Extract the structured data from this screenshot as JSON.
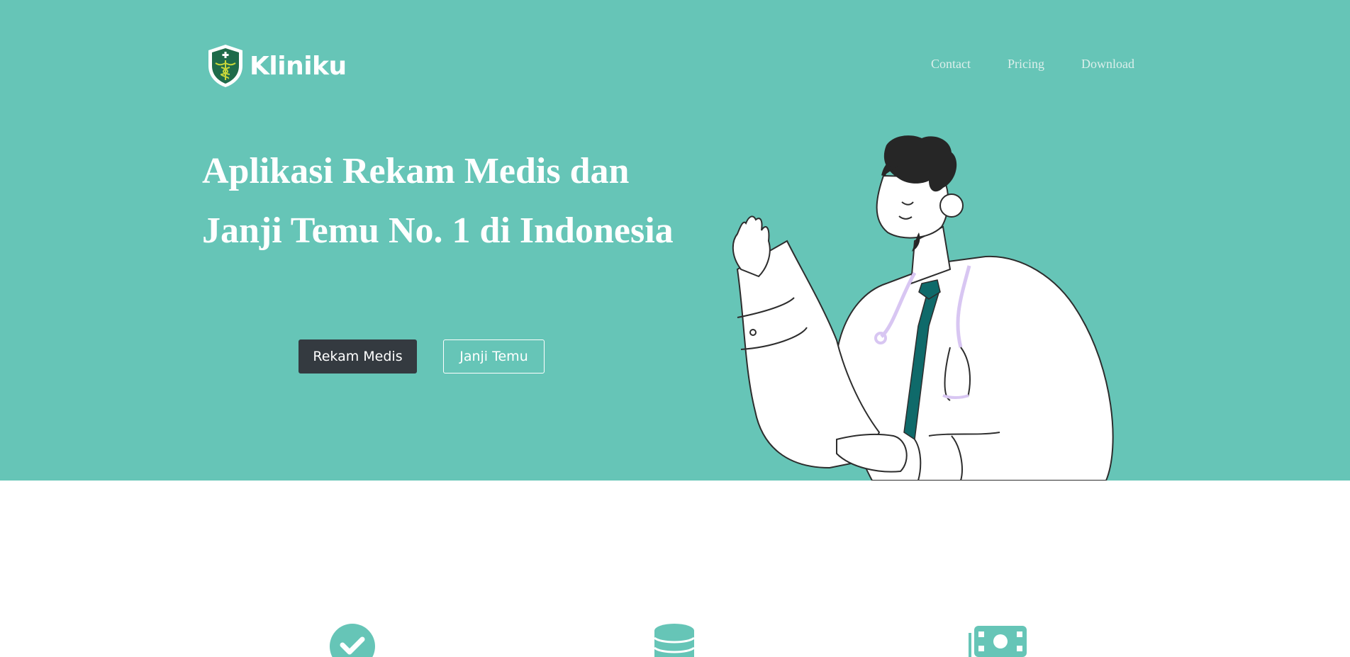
{
  "brand": {
    "name": "Kliniku",
    "logo_icon": "caduceus-shield-icon"
  },
  "nav": {
    "links": [
      "Contact",
      "Pricing",
      "Download"
    ]
  },
  "hero": {
    "title": "Aplikasi Rekam Medis dan Janji Temu No. 1 di Indonesia",
    "primary_button": "Rekam Medis",
    "secondary_button": "Janji Temu",
    "illustration": "doctor-illustration"
  },
  "features": {
    "icons": [
      "check-circle-icon",
      "database-icon",
      "money-bill-icon"
    ]
  },
  "colors": {
    "hero_bg": "#66c5b7",
    "button_dark": "#343a40",
    "white": "#ffffff"
  }
}
